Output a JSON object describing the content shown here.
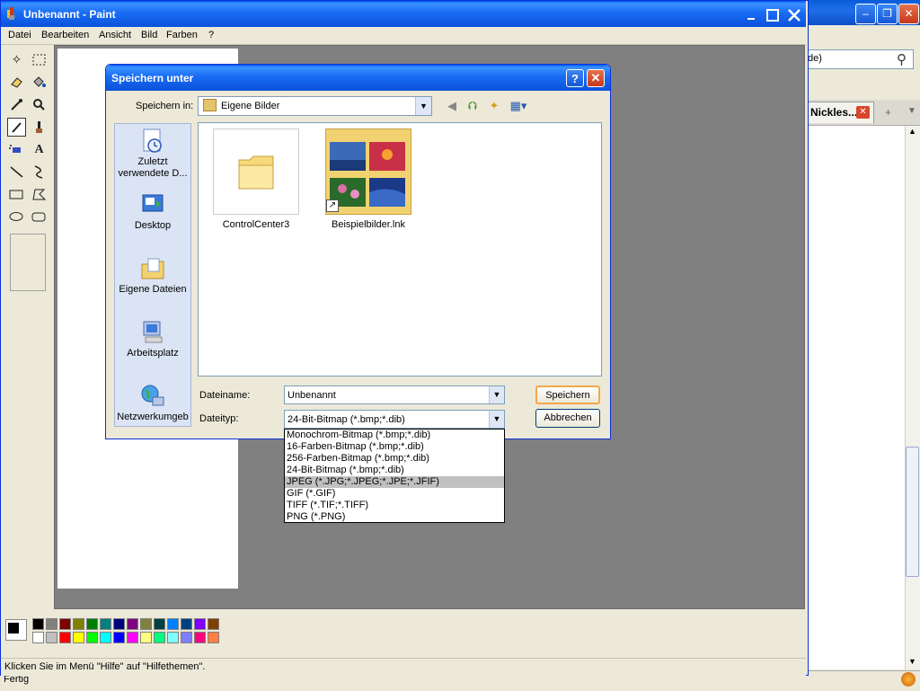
{
  "browser": {
    "search_text": "de)",
    "tab_label": "Nickles...",
    "status_text": "Fertig"
  },
  "paint": {
    "title": "Unbenannt - Paint",
    "menu": [
      "Datei",
      "Bearbeiten",
      "Ansicht",
      "Bild",
      "Farben",
      "?"
    ],
    "status_text": "Klicken Sie im Menü \"Hilfe\" auf \"Hilfethemen\".",
    "tools": [
      "free-select-icon",
      "rect-select-icon",
      "eraser-icon",
      "fill-icon",
      "eyedropper-icon",
      "magnifier-icon",
      "pencil-icon",
      "brush-icon",
      "airbrush-icon",
      "text-icon",
      "line-icon",
      "curve-icon",
      "rectangle-icon",
      "polygon-icon",
      "ellipse-icon",
      "rounded-rect-icon"
    ],
    "palette_top": [
      "#000000",
      "#808080",
      "#800000",
      "#808000",
      "#008000",
      "#008080",
      "#000080",
      "#800080",
      "#808040",
      "#004040",
      "#0080ff",
      "#004080",
      "#8000ff",
      "#804000"
    ],
    "palette_bottom": [
      "#ffffff",
      "#c0c0c0",
      "#ff0000",
      "#ffff00",
      "#00ff00",
      "#00ffff",
      "#0000ff",
      "#ff00ff",
      "#ffff80",
      "#00ff80",
      "#80ffff",
      "#8080ff",
      "#ff0080",
      "#ff8040"
    ]
  },
  "dialog": {
    "title": "Speichern unter",
    "help_label": "?",
    "save_in_label": "Speichern in:",
    "save_in_value": "Eigene Bilder",
    "places": [
      {
        "label": "Zuletzt verwendete D..."
      },
      {
        "label": "Desktop"
      },
      {
        "label": "Eigene Dateien"
      },
      {
        "label": "Arbeitsplatz"
      },
      {
        "label": "Netzwerkumgeb"
      }
    ],
    "files": [
      {
        "name": "ControlCenter3"
      },
      {
        "name": "Beispielbilder.lnk"
      }
    ],
    "filename_label": "Dateiname:",
    "filename_value": "Unbenannt",
    "filetype_label": "Dateityp:",
    "filetype_value": "24-Bit-Bitmap (*.bmp;*.dib)",
    "save_button": "Speichern",
    "cancel_button": "Abbrechen",
    "filetype_options": [
      "Monochrom-Bitmap (*.bmp;*.dib)",
      "16-Farben-Bitmap (*.bmp;*.dib)",
      "256-Farben-Bitmap (*.bmp;*.dib)",
      "24-Bit-Bitmap (*.bmp;*.dib)",
      "JPEG (*.JPG;*.JPEG;*.JPE;*.JFIF)",
      "GIF (*.GIF)",
      "TIFF (*.TIF;*.TIFF)",
      "PNG (*.PNG)"
    ],
    "highlighted_option": 4
  }
}
